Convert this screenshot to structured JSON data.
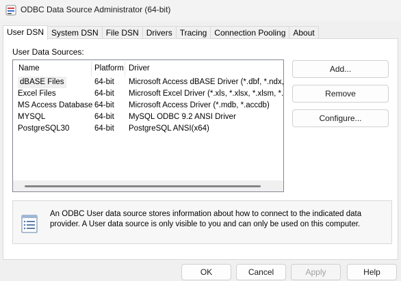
{
  "window": {
    "title": "ODBC Data Source Administrator (64-bit)"
  },
  "tabs": [
    {
      "label": "User DSN",
      "active": true
    },
    {
      "label": "System DSN"
    },
    {
      "label": "File DSN"
    },
    {
      "label": "Drivers"
    },
    {
      "label": "Tracing"
    },
    {
      "label": "Connection Pooling"
    },
    {
      "label": "About"
    }
  ],
  "section": {
    "label": "User Data Sources:"
  },
  "list": {
    "columns": [
      "Name",
      "Platform",
      "Driver"
    ],
    "rows": [
      {
        "name": "dBASE Files",
        "platform": "64-bit",
        "driver": "Microsoft Access dBASE Driver (*.dbf, *.ndx, *.m"
      },
      {
        "name": "Excel Files",
        "platform": "64-bit",
        "driver": "Microsoft Excel Driver (*.xls, *.xlsx, *.xlsm, *.xlsb)"
      },
      {
        "name": "MS Access Database",
        "platform": "64-bit",
        "driver": "Microsoft Access Driver (*.mdb, *.accdb)"
      },
      {
        "name": "MYSQL",
        "platform": "64-bit",
        "driver": "MySQL ODBC 9.2 ANSI Driver"
      },
      {
        "name": "PostgreSQL30",
        "platform": "64-bit",
        "driver": "PostgreSQL ANSI(x64)"
      }
    ]
  },
  "side_buttons": {
    "add": "Add...",
    "remove": "Remove",
    "configure": "Configure..."
  },
  "info": {
    "text": "An ODBC User data source stores information about how to connect to the indicated data provider.   A User data source is only visible to you and can only be used on this computer."
  },
  "footer": {
    "ok": "OK",
    "cancel": "Cancel",
    "apply": "Apply",
    "help": "Help"
  },
  "icons": {
    "app": "odbc-admin-icon",
    "info": "data-sources-icon"
  }
}
